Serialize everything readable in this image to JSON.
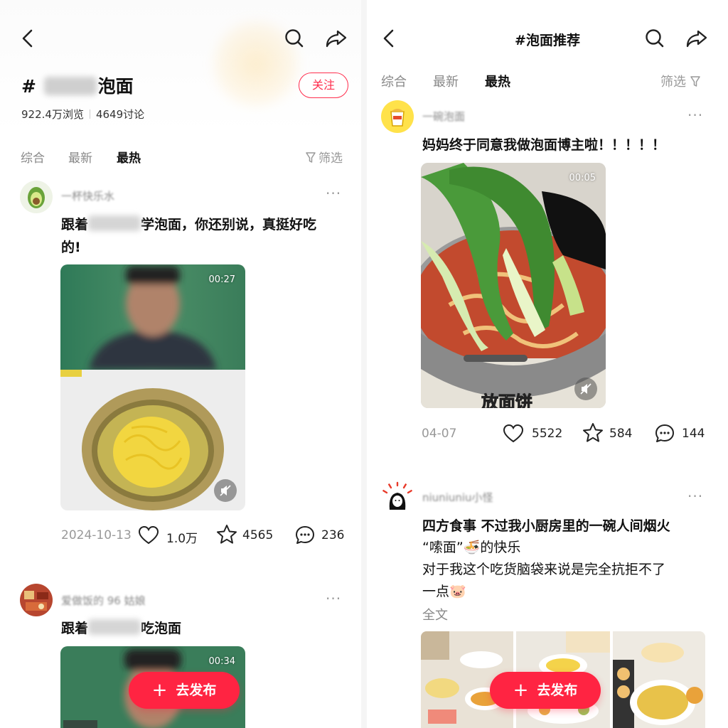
{
  "left": {
    "title_prefix": "# ",
    "title_suffix": "泡面",
    "stats": {
      "views": "922.4万浏览",
      "discussions": "4649讨论"
    },
    "follow_label": "关注",
    "tabs": [
      "综合",
      "最新",
      "最热"
    ],
    "filter_label": "筛选",
    "post1": {
      "username": "一杯快乐水",
      "text_before": "跟着",
      "text_after": "学泡面，你还别说，真挺好吃",
      "text_line2": "的!",
      "duration": "00:27",
      "date": "2024-10-13",
      "likes": "1.0万",
      "stars": "4565",
      "comments": "236"
    },
    "post2": {
      "username": "爱做饭的 96 姑娘",
      "text_before": "跟着",
      "text_after": "吃泡面",
      "duration": "00:34"
    },
    "publish_label": "去发布"
  },
  "right": {
    "title": "#泡面推荐",
    "tabs": [
      "综合",
      "最新",
      "最热"
    ],
    "filter_label": "筛选",
    "post1": {
      "username": "一碗泡面",
      "text": "妈妈终于同意我做泡面博主啦！！！！！",
      "duration": "00:05",
      "subtitle": "放面饼",
      "date": "04-07",
      "likes": "5522",
      "stars": "584",
      "comments": "144"
    },
    "post2": {
      "username": "niuniuniu小怪",
      "lines": [
        "四方食事 不过我小厨房里的一碗人间烟火",
        "“嗦面”🍜的快乐",
        "对于我这个吃货脑袋来说是完全抗拒不了",
        "一点🐷"
      ],
      "more_label": "全文"
    },
    "publish_label": "去发布"
  },
  "colors": {
    "accent": "#ff2442",
    "follow": "#ff2e4d",
    "muted": "#999999"
  },
  "icons": [
    "back-icon",
    "search-icon",
    "share-icon",
    "filter-icon",
    "heart-icon",
    "star-icon",
    "comment-icon",
    "mute-icon",
    "plus-icon"
  ]
}
